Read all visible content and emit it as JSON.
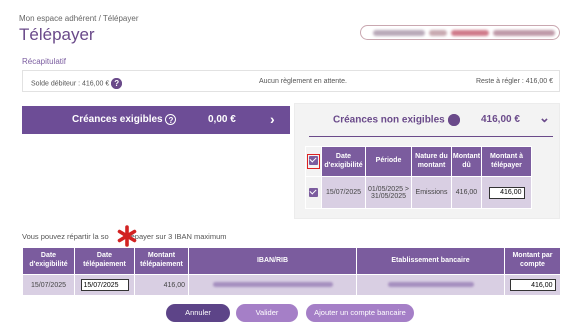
{
  "breadcrumb": "Mon espace adhérent / Télépayer",
  "title": "Télépayer",
  "recap": {
    "title": "Récapitulatif",
    "solde": "Solde débiteur : 416,00 €",
    "attente": "Aucun règlement en attente.",
    "reste": "Reste à régler : 416,00 €"
  },
  "exigibles": {
    "label": "Créances exigibles",
    "amount": "0,00 €",
    "chevron": "›"
  },
  "non_exigibles": {
    "label": "Créances non exigibles",
    "amount": "416,00 €",
    "chevron": "⌄",
    "headers": {
      "date": [
        "Date",
        "d'exigibilité"
      ],
      "periode": "Période",
      "nature": [
        "Nature du",
        "montant"
      ],
      "montant_du": [
        "Montant",
        "dû"
      ],
      "montant_tele": [
        "Montant à",
        "télépayer"
      ]
    },
    "row": {
      "date": "15/07/2025",
      "periode_from": "01/05/2025 >",
      "periode_to": "31/05/2025",
      "nature": "Emissions",
      "montant_du": "416,00",
      "montant_tele": "416,00"
    }
  },
  "split": {
    "before": "Vous pouvez répartir la so",
    "after": "télépayer sur 3 IBAN maximum"
  },
  "repartition": {
    "headers": {
      "date_exig": [
        "Date",
        "d'exigibilité"
      ],
      "date_tele": [
        "Date",
        "télépaiement"
      ],
      "montant_tele": [
        "Montant",
        "télépaiement"
      ],
      "iban": "IBAN/RIB",
      "etab": "Etablissement bancaire",
      "montant_compte": [
        "Montant par",
        "compte"
      ]
    },
    "row": {
      "date_exig": "15/07/2025",
      "date_tele": "15/07/2025",
      "montant": "416,00",
      "montant_compte": "416,00"
    }
  },
  "buttons": {
    "annuler": "Annuler",
    "valider": "Valider",
    "ajouter": "Ajouter un compte bancaire"
  },
  "colors": {
    "primary": "#6d4d96",
    "light": "#a57fc7",
    "row": "#d9cfe3",
    "accent_red": "#d22222"
  },
  "icons": {
    "help": "help-icon",
    "chevron_right": "chevron-right-icon",
    "chevron_down": "chevron-down-icon",
    "checkbox": "checkbox-checked-icon",
    "star": "asterisk-icon"
  }
}
